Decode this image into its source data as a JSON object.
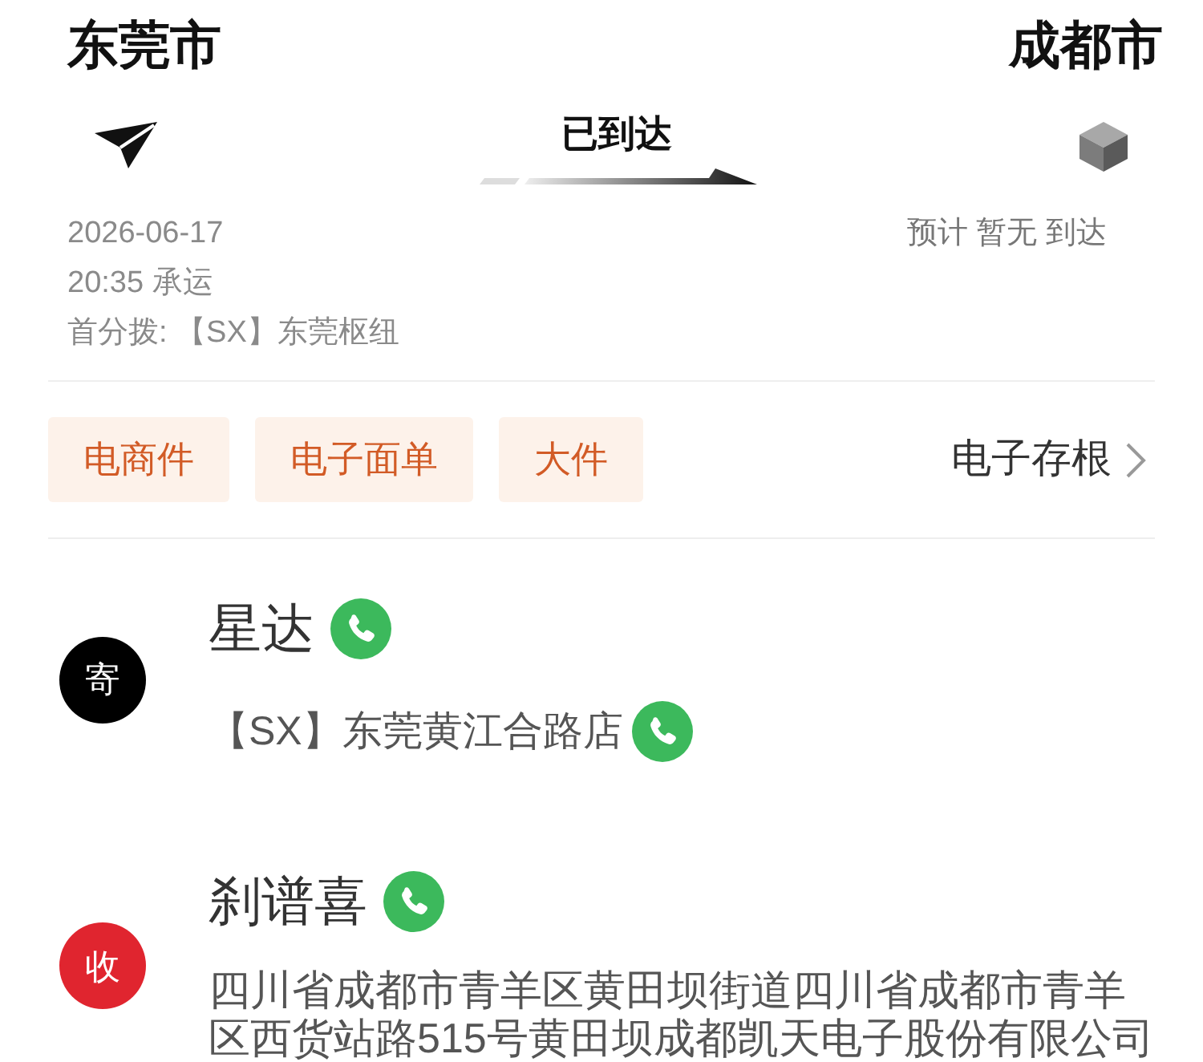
{
  "route": {
    "origin": "东莞市",
    "destination": "成都市",
    "status": "已到达"
  },
  "origin_info": [
    "2026-06-17",
    "20:35 承运",
    "首分拨: 【SX】东莞枢纽"
  ],
  "eta": "预计 暂无 到达",
  "tags": [
    "电商件",
    "电子面单",
    "大件"
  ],
  "stub_link": {
    "label": "电子存根"
  },
  "parties": [
    {
      "badge": "寄",
      "color": "#000000",
      "name": "星达",
      "name_phone": true,
      "address": "【SX】东莞黄江合路店",
      "address_phone": true
    },
    {
      "badge": "收",
      "color": "#e0252f",
      "name": "刹谱喜",
      "name_phone": true,
      "address": "四川省成都市青羊区黄田坝街道四川省成都市青羊区西货站路515号黄田坝成都凯天电子股份有限公司",
      "address_phone": false
    }
  ]
}
